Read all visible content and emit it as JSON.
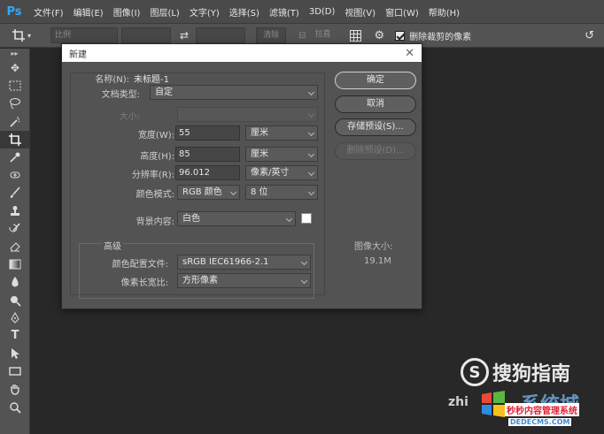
{
  "app": {
    "logo": "Ps"
  },
  "menubar": {
    "items": [
      "文件(F)",
      "编辑(E)",
      "图像(I)",
      "图层(L)",
      "文字(Y)",
      "选择(S)",
      "滤镜(T)",
      "3D(D)",
      "视图(V)",
      "窗口(W)",
      "帮助(H)"
    ]
  },
  "optionsbar": {
    "ratio_placeholder": "比例",
    "clear_label": "清除",
    "straighten_label": "拉直",
    "delete_cropped_label": "删除裁剪的像素",
    "delete_cropped_checked": true
  },
  "dialog": {
    "title": "新建",
    "name_label": "名称(N):",
    "name_value": "未标题-1",
    "preset_label": "文档类型:",
    "preset_value": "自定",
    "size_label": "大小:",
    "size_value": "",
    "width_label": "宽度(W):",
    "width_value": "55",
    "width_unit": "厘米",
    "height_label": "高度(H):",
    "height_value": "85",
    "height_unit": "厘米",
    "resolution_label": "分辨率(R):",
    "resolution_value": "96.012",
    "resolution_unit": "像素/英寸",
    "color_mode_label": "颜色模式:",
    "color_mode_value": "RGB 颜色",
    "bit_depth_value": "8 位",
    "background_label": "背景内容:",
    "background_value": "白色",
    "background_color": "#ffffff",
    "advanced_label": "高级",
    "color_profile_label": "颜色配置文件:",
    "color_profile_value": "sRGB IEC61966-2.1",
    "pixel_aspect_label": "像素长宽比:",
    "pixel_aspect_value": "方形像素",
    "buttons": {
      "ok": "确定",
      "cancel": "取消",
      "save_preset": "存储预设(S)...",
      "delete_preset": "删除预设(D)..."
    },
    "image_size_label": "图像大小:",
    "image_size_value": "19.1M"
  },
  "watermark": {
    "sogou_text": "搜狗指南",
    "sogou_letter": "S",
    "zhi_text": "zhi",
    "xitong_text": "系统城",
    "tagline": "秒秒内容管理系统",
    "url": "DEDECMS.COM"
  }
}
